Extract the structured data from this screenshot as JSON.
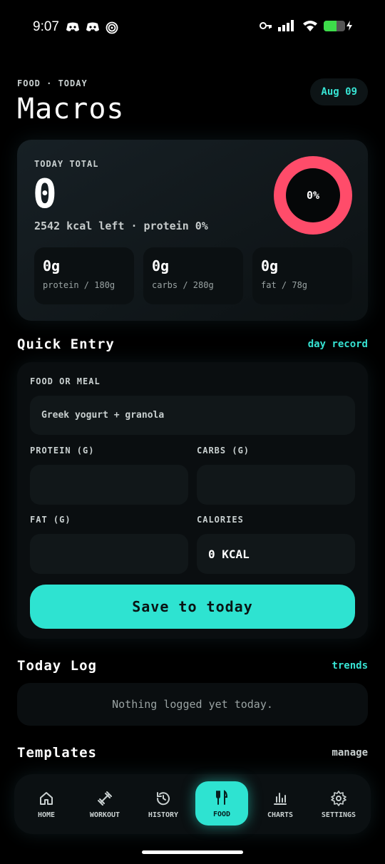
{
  "status": {
    "time": "9:07"
  },
  "header": {
    "eyebrow": "FOOD · TODAY",
    "title": "Macros",
    "date": "Aug 09"
  },
  "totals": {
    "label": "TODAY TOTAL",
    "value": "0",
    "summary": "2542 kcal left · protein 0%",
    "ring_percent": "0%",
    "ring_color": "#ff4c6a",
    "macros": [
      {
        "value": "0g",
        "sub": "protein / 180g"
      },
      {
        "value": "0g",
        "sub": "carbs / 280g"
      },
      {
        "value": "0g",
        "sub": "fat / 78g"
      }
    ]
  },
  "quick_entry": {
    "title": "Quick Entry",
    "link": "day record",
    "food_label": "FOOD OR MEAL",
    "food_placeholder": "Greek yogurt + granola",
    "protein_label": "PROTEIN (G)",
    "carbs_label": "CARBS (G)",
    "fat_label": "FAT (G)",
    "calories_label": "CALORIES",
    "calories_value": "0 KCAL",
    "save_label": "Save to today"
  },
  "today_log": {
    "title": "Today Log",
    "link": "trends",
    "empty": "Nothing logged yet today."
  },
  "templates": {
    "title": "Templates",
    "link": "manage"
  },
  "nav": {
    "items": [
      {
        "label": "HOME",
        "icon": "home-icon"
      },
      {
        "label": "WORKOUT",
        "icon": "dumbbell-icon"
      },
      {
        "label": "HISTORY",
        "icon": "history-icon"
      },
      {
        "label": "FOOD",
        "icon": "utensils-icon"
      },
      {
        "label": "CHARTS",
        "icon": "bar-chart-icon"
      },
      {
        "label": "SETTINGS",
        "icon": "gear-icon"
      }
    ],
    "active": "FOOD",
    "accent": "#2ee3d1"
  }
}
